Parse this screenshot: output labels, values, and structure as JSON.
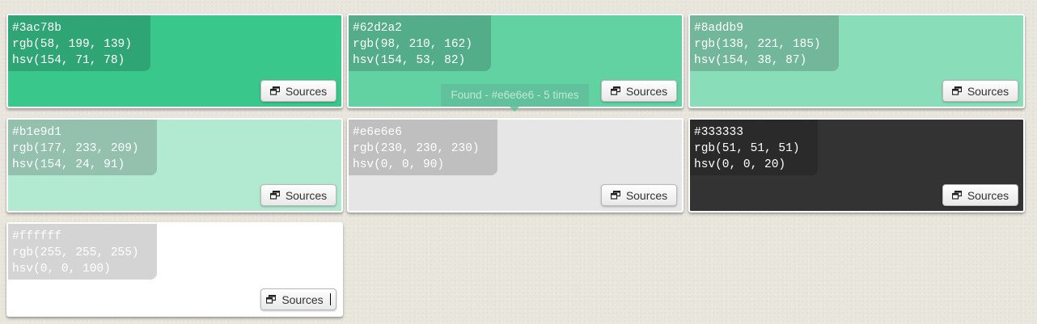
{
  "swatches": [
    {
      "hex": "#3ac78b",
      "rgb": "rgb(58, 199, 139)",
      "hsv": "hsv(154, 71, 78)",
      "bg": "#3ac78b",
      "info_bg": "#2fa474",
      "text_color": "#ffffff",
      "button_label": "Sources"
    },
    {
      "hex": "#62d2a2",
      "rgb": "rgb(98, 210, 162)",
      "hsv": "hsv(154, 53, 82)",
      "bg": "#62d2a2",
      "info_bg": "#52ad88",
      "text_color": "#ffffff",
      "button_label": "Sources"
    },
    {
      "hex": "#8addb9",
      "rgb": "rgb(138, 221, 185)",
      "hsv": "hsv(154, 38, 87)",
      "bg": "#8addb9",
      "info_bg": "#72b79a",
      "text_color": "#ffffff",
      "button_label": "Sources"
    },
    {
      "hex": "#b1e9d1",
      "rgb": "rgb(177, 233, 209)",
      "hsv": "hsv(154, 24, 91)",
      "bg": "#b1e9d1",
      "info_bg": "#93c1ad",
      "text_color": "#ffffff",
      "button_label": "Sources"
    },
    {
      "hex": "#e6e6e6",
      "rgb": "rgb(230, 230, 230)",
      "hsv": "hsv(0, 0, 90)",
      "bg": "#e6e6e6",
      "info_bg": "#bfbfbf",
      "text_color": "#ffffff",
      "button_label": "Sources"
    },
    {
      "hex": "#333333",
      "rgb": "rgb(51, 51, 51)",
      "hsv": "hsv(0, 0, 20)",
      "bg": "#333333",
      "info_bg": "#2a2a2a",
      "text_color": "#ffffff",
      "button_label": "Sources"
    },
    {
      "hex": "#ffffff",
      "rgb": "rgb(255, 255, 255)",
      "hsv": "hsv(0, 0, 100)",
      "bg": "#ffffff",
      "info_bg": "#d4d4d4",
      "text_color": "#ffffff",
      "button_label": "Sources"
    }
  ],
  "tooltip": {
    "text": "Found - #e6e6e6 - 5 times"
  },
  "icons": {
    "sources_button": "external-window-icon"
  }
}
